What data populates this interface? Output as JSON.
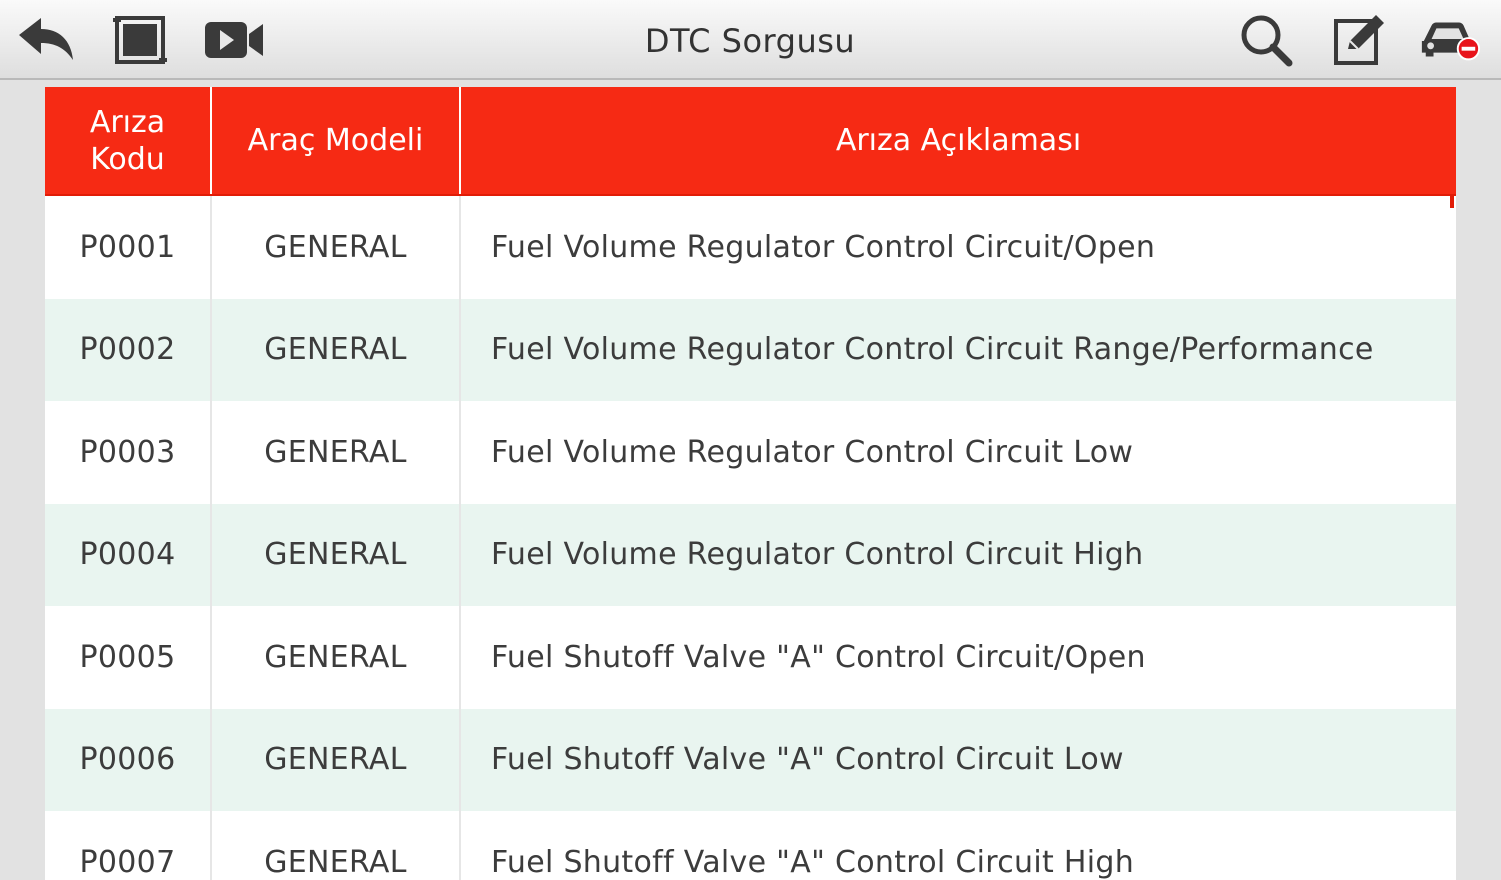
{
  "app": {
    "title": "DTC Sorgusu"
  },
  "toolbar": {
    "icons": [
      "back-arrow-icon",
      "screenshot-frame-icon",
      "video-record-icon",
      "search-icon",
      "edit-note-icon",
      "car-disconnect-icon"
    ],
    "accent_color": "#f62a14",
    "disconnect_badge_color": "#e8141b"
  },
  "table": {
    "headers": {
      "code": "Arıza Kodu",
      "model": "Araç Modeli",
      "description": "Arıza Açıklaması"
    },
    "rows": [
      {
        "code": "P0001",
        "model": "GENERAL",
        "description": "Fuel Volume Regulator Control Circuit/Open"
      },
      {
        "code": "P0002",
        "model": "GENERAL",
        "description": "Fuel Volume Regulator Control Circuit Range/Performance"
      },
      {
        "code": "P0003",
        "model": "GENERAL",
        "description": "Fuel Volume Regulator Control Circuit Low"
      },
      {
        "code": "P0004",
        "model": "GENERAL",
        "description": "Fuel Volume Regulator Control Circuit High"
      },
      {
        "code": "P0005",
        "model": "GENERAL",
        "description": "Fuel Shutoff Valve \"A\" Control Circuit/Open"
      },
      {
        "code": "P0006",
        "model": "GENERAL",
        "description": "Fuel Shutoff Valve \"A\" Control Circuit Low"
      },
      {
        "code": "P0007",
        "model": "GENERAL",
        "description": "Fuel Shutoff Valve \"A\" Control Circuit High"
      }
    ],
    "header_bg": "#f62a14",
    "row_alt_bg": "#e9f5f0"
  }
}
